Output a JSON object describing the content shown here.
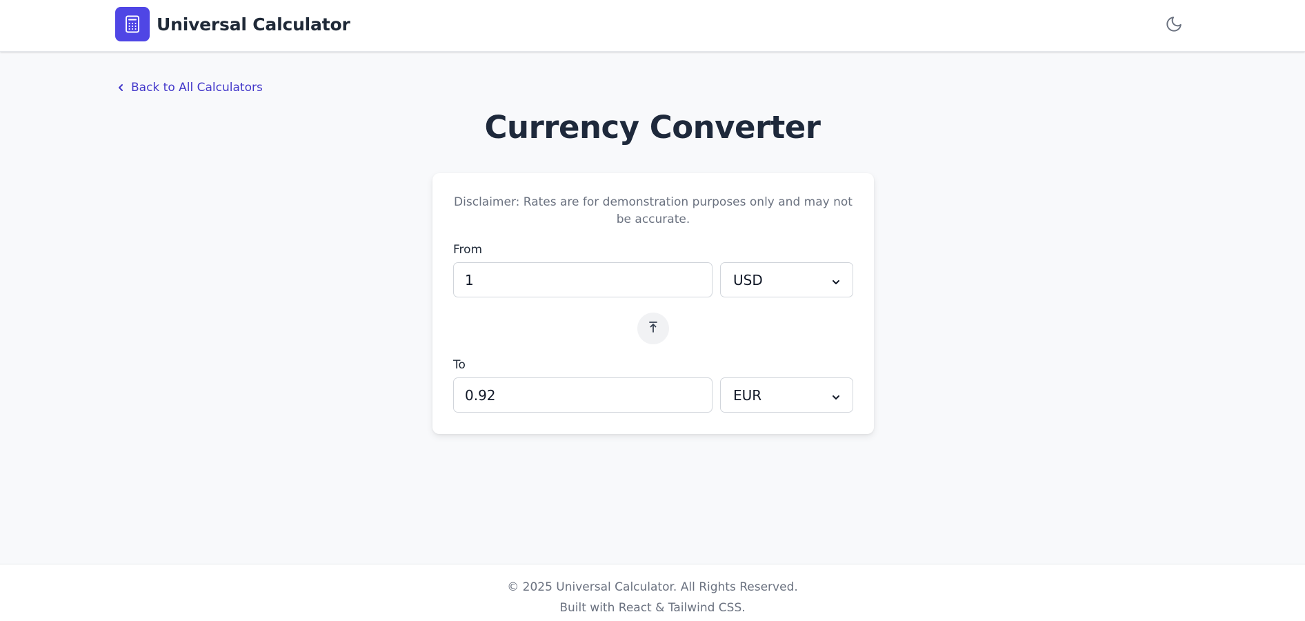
{
  "header": {
    "logo_icon": "calculator-icon",
    "title": "Universal Calculator",
    "theme_toggle_icon": "moon-icon"
  },
  "nav": {
    "back_label": "Back to All Calculators",
    "back_icon": "chevron-left-icon"
  },
  "page": {
    "title": "Currency Converter"
  },
  "converter": {
    "disclaimer": "Disclaimer: Rates are for demonstration purposes only and may not be accurate.",
    "from_label": "From",
    "from_amount": "1",
    "from_currency": "USD",
    "swap_icon": "swap-arrow-icon",
    "to_label": "To",
    "to_amount": "0.92",
    "to_currency": "EUR"
  },
  "footer": {
    "copyright": "© 2025 Universal Calculator. All Rights Reserved.",
    "built_with": "Built with React & Tailwind CSS."
  },
  "colors": {
    "accent": "#4f46e5",
    "link": "#4338ca",
    "background": "#f8f9fb",
    "card": "#ffffff",
    "muted_text": "#6b7280"
  }
}
